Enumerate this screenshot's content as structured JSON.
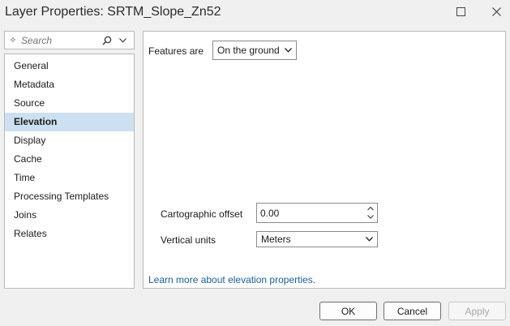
{
  "window": {
    "title": "Layer Properties: SRTM_Slope_Zn52"
  },
  "search": {
    "placeholder": "Search"
  },
  "nav": {
    "items": [
      {
        "label": "General"
      },
      {
        "label": "Metadata"
      },
      {
        "label": "Source"
      },
      {
        "label": "Elevation"
      },
      {
        "label": "Display"
      },
      {
        "label": "Cache"
      },
      {
        "label": "Time"
      },
      {
        "label": "Processing Templates"
      },
      {
        "label": "Joins"
      },
      {
        "label": "Relates"
      }
    ],
    "selected": "Elevation"
  },
  "elevation": {
    "features_label": "Features are",
    "features_value": "On the ground",
    "offset_label": "Cartographic offset",
    "offset_value": "0.00",
    "units_label": "Vertical units",
    "units_value": "Meters",
    "help_link": "Learn more about elevation properties."
  },
  "buttons": {
    "ok": "OK",
    "cancel": "Cancel",
    "apply": "Apply"
  },
  "colors": {
    "selected_bg": "#cce0f2",
    "link": "#1a5fa0"
  }
}
